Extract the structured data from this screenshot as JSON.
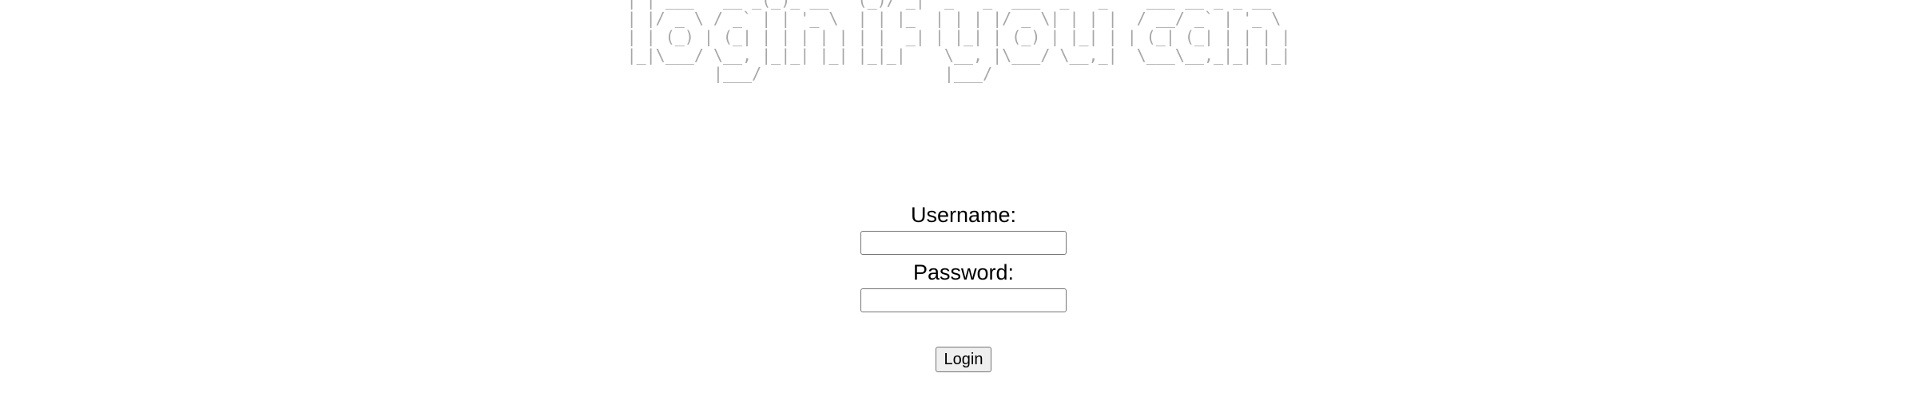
{
  "banner": {
    "ascii_art": " _             _         _  __                                   \n| | ___   __ _(_)_ __   (_)/ _|  _   _  ___  _   _    ___ __ _ _ __  \n| |/ _ \\ / _` | | '_ \\  | | |_  | | | |/ _ \\| | | |  / __/ _` | '_ \\ \n| | (_) | (_| | | | | | | |  _| | |_| | (_) | |_| | | (_| (_| | | | |\n|_|\\___/ \\__, |_|_| |_| |_|_|    \\__, |\\___/ \\__,_|  \\___\\__,_|_| |_|\n         |___/                   |___/                                "
  },
  "form": {
    "username_label": "Username:",
    "username_value": "",
    "password_label": "Password:",
    "password_value": "",
    "submit_label": "Login"
  }
}
